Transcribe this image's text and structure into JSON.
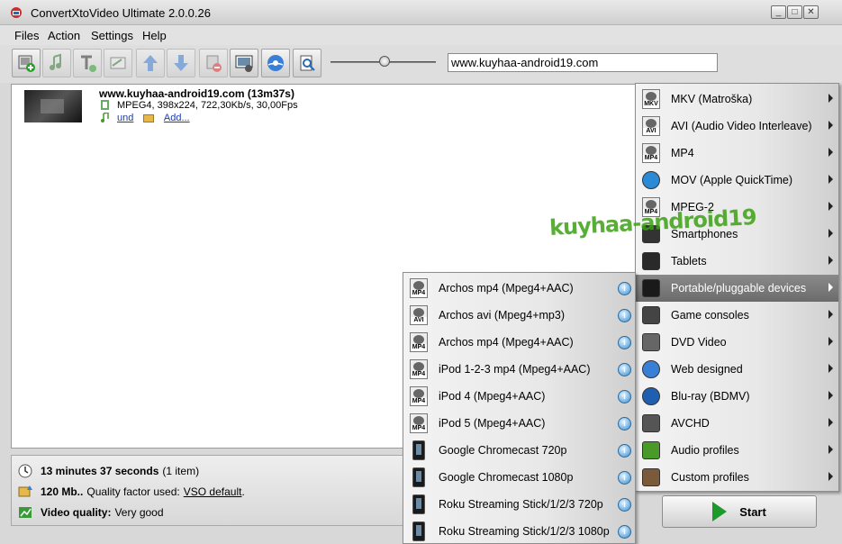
{
  "window": {
    "title": "ConvertXtoVideo Ultimate 2.0.0.26",
    "controls": [
      "_",
      "□",
      "✕"
    ]
  },
  "menubar": [
    "Files",
    "Action",
    "Settings",
    "Help"
  ],
  "toolbar": {
    "buttons": [
      "add-file-icon",
      "add-audio-icon",
      "add-text-icon",
      "edit-icon",
      "move-up-icon",
      "move-down-icon",
      "remove-icon",
      "preview-icon",
      "disc-icon",
      "zoom-icon"
    ],
    "output_name": "www.kuyhaa-android19.com"
  },
  "file_item": {
    "title": "www.kuyhaa-android19.com (13m37s)",
    "info": "MPEG4, 398x224, 722,30Kb/s, 30,00Fps",
    "audio_link": "und",
    "add_link": "Add..."
  },
  "status": {
    "duration_bold": "13 minutes 37 seconds",
    "duration_rest": "(1 item)",
    "size_bold": "120 Mb..",
    "size_rest": "Quality factor used:",
    "size_link": "VSO default",
    "size_tail": ".",
    "quality_bold": "Video quality:",
    "quality_rest": "Very good"
  },
  "start_label": "Start",
  "main_menu": [
    {
      "label": "MKV (Matroška)",
      "icon": "MKV"
    },
    {
      "label": "AVI (Audio Video Interleave)",
      "icon": "AVI"
    },
    {
      "label": "MP4",
      "icon": "MP4"
    },
    {
      "label": "MOV (Apple QuickTime)",
      "icon": "quicktime-icon"
    },
    {
      "label": "MPEG-2",
      "icon": "MP4"
    },
    {
      "label": "Smartphones",
      "icon": "smartphone-icon"
    },
    {
      "label": "Tablets",
      "icon": "tablet-icon"
    },
    {
      "label": "Portable/pluggable devices",
      "icon": "portable-device-icon",
      "selected": true
    },
    {
      "label": "Game consoles",
      "icon": "gamepad-icon"
    },
    {
      "label": "DVD Video",
      "icon": "dvd-icon"
    },
    {
      "label": "Web designed",
      "icon": "web-icon"
    },
    {
      "label": "Blu-ray (BDMV)",
      "icon": "bluray-icon"
    },
    {
      "label": "AVCHD",
      "icon": "camera-icon"
    },
    {
      "label": "Audio profiles",
      "icon": "music-icon"
    },
    {
      "label": "Custom profiles",
      "icon": "person-icon"
    }
  ],
  "sub_menu": [
    {
      "label": "Archos mp4 (Mpeg4+AAC)",
      "icon": "MP4"
    },
    {
      "label": "Archos avi  (Mpeg4+mp3)",
      "icon": "AVI"
    },
    {
      "label": "Archos mp4 (Mpeg4+AAC)",
      "icon": "MP4"
    },
    {
      "label": "iPod 1-2-3 mp4 (Mpeg4+AAC)",
      "icon": "MP4"
    },
    {
      "label": "iPod 4 (Mpeg4+AAC)",
      "icon": "MP4"
    },
    {
      "label": "iPod 5 (Mpeg4+AAC)",
      "icon": "MP4"
    },
    {
      "label": "Google Chromecast 720p",
      "icon": "device"
    },
    {
      "label": "Google Chromecast 1080p",
      "icon": "device"
    },
    {
      "label": "Roku Streaming Stick/1/2/3 720p",
      "icon": "device"
    },
    {
      "label": "Roku Streaming Stick/1/2/3 1080p",
      "icon": "device"
    }
  ],
  "info_glyph": "i",
  "watermark": "kuyhaa-android19"
}
